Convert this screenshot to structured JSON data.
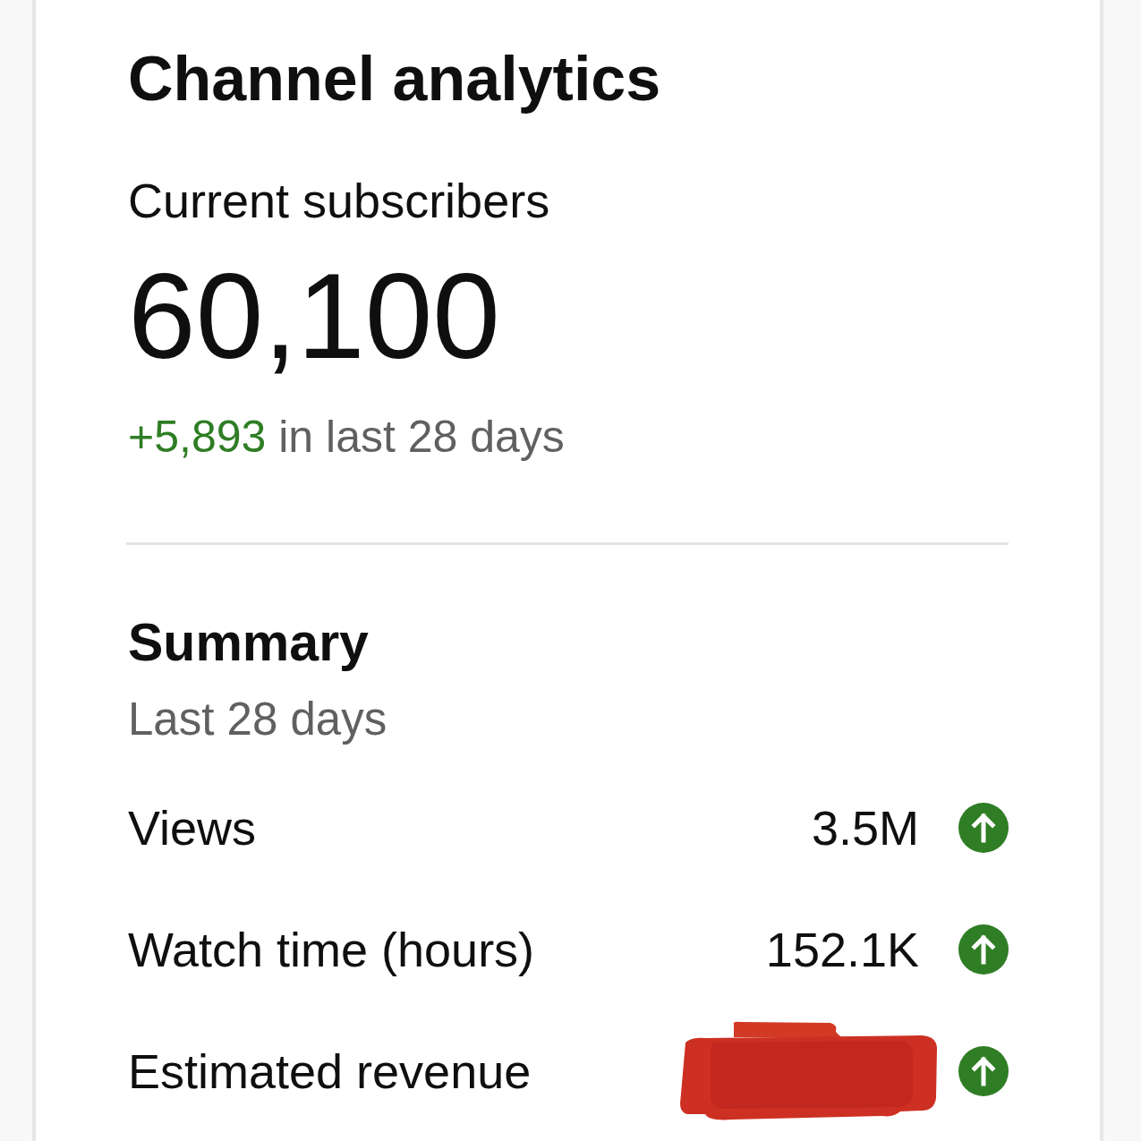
{
  "card": {
    "title": "Channel analytics"
  },
  "subscribers": {
    "label": "Current subscribers",
    "count": "60,100",
    "change": "+5,893",
    "change_period": "in last 28 days",
    "increase": true
  },
  "summary": {
    "title": "Summary",
    "period": "Last 28 days",
    "metrics": [
      {
        "label": "Views",
        "value": "3.5M",
        "increase": true,
        "redacted": false
      },
      {
        "label": "Watch time (hours)",
        "value": "152.1K",
        "increase": true,
        "redacted": false
      },
      {
        "label": "Estimated revenue",
        "increase": true,
        "redacted": true
      }
    ]
  }
}
